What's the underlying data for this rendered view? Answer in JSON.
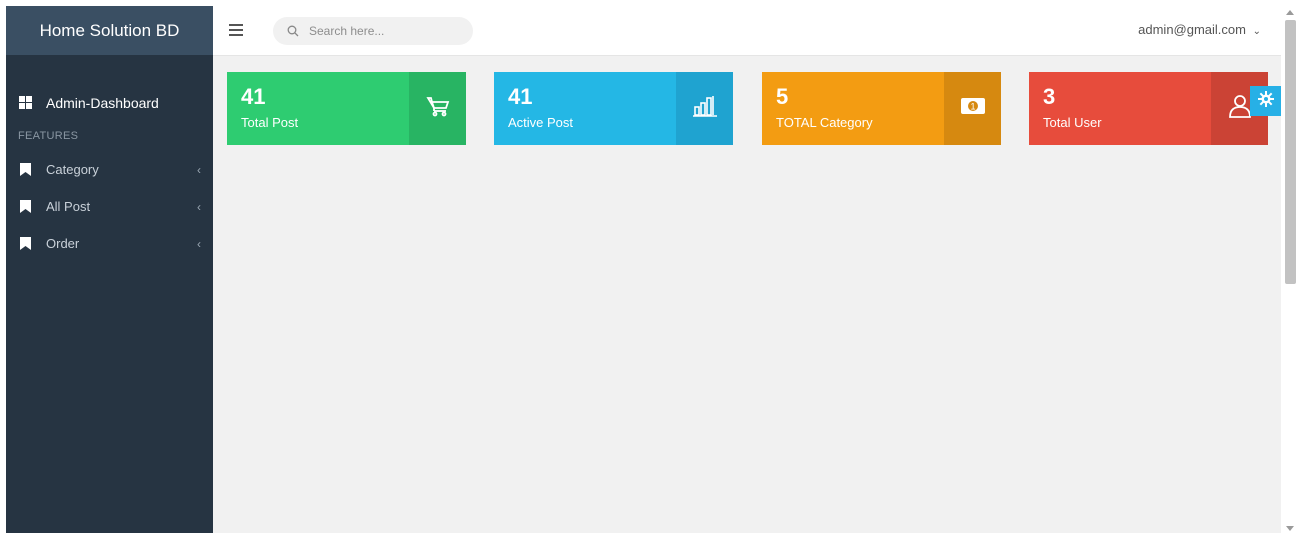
{
  "app": {
    "title": "Home Solution BD"
  },
  "sidebar": {
    "dashboard_label": "Admin-Dashboard",
    "section_label": "FEATURES",
    "items": [
      {
        "label": "Category",
        "icon": "bookmark-icon"
      },
      {
        "label": "All Post",
        "icon": "bookmark-icon"
      },
      {
        "label": "Order",
        "icon": "bookmark-icon"
      }
    ]
  },
  "header": {
    "search_placeholder": "Search here...",
    "user_email": "admin@gmail.com"
  },
  "cards": [
    {
      "count": "41",
      "label": "Total Post",
      "icon": "cart-icon",
      "color": "#2ecc71",
      "icon_bg": "#28b463"
    },
    {
      "count": "41",
      "label": "Active Post",
      "icon": "bar-chart-icon",
      "color": "#24b7e5",
      "icon_bg": "#1fa3d0"
    },
    {
      "count": "5",
      "label": "TOTAL Category",
      "icon": "money-icon",
      "color": "#f39c12",
      "icon_bg": "#d68910"
    },
    {
      "count": "3",
      "label": "Total User",
      "icon": "user-icon",
      "color": "#e74c3c",
      "icon_bg": "#cb4335"
    }
  ],
  "colors": {
    "sidebar_bg": "#263442",
    "brand_bg": "#3a4f63",
    "settings_accent": "#27b0e6"
  }
}
